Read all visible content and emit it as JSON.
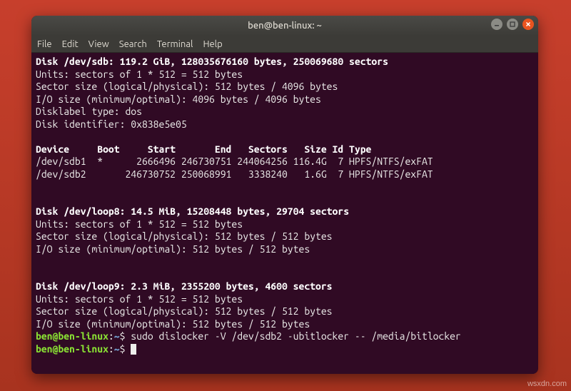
{
  "window": {
    "title": "ben@ben-linux: ~"
  },
  "menu": {
    "file": "File",
    "edit": "Edit",
    "view": "View",
    "search": "Search",
    "terminal": "Terminal",
    "help": "Help"
  },
  "out": {
    "sdb_header": "Disk /dev/sdb: 119.2 GiB, 128035676160 bytes, 250069680 sectors",
    "sdb_units": "Units: sectors of 1 * 512 = 512 bytes",
    "sdb_secsize": "Sector size (logical/physical): 512 bytes / 4096 bytes",
    "sdb_iosize": "I/O size (minimum/optimal): 4096 bytes / 4096 bytes",
    "sdb_label": "Disklabel type: dos",
    "sdb_ident": "Disk identifier: 0x838e5e05",
    "blank1": "",
    "part_header": "Device     Boot     Start       End   Sectors   Size Id Type",
    "part_row1": "/dev/sdb1  *      2666496 246730751 244064256 116.4G  7 HPFS/NTFS/exFAT",
    "part_row2": "/dev/sdb2       246730752 250068991   3338240   1.6G  7 HPFS/NTFS/exFAT",
    "blank2": "",
    "blank3": "",
    "loop8_header": "Disk /dev/loop8: 14.5 MiB, 15208448 bytes, 29704 sectors",
    "loop8_units": "Units: sectors of 1 * 512 = 512 bytes",
    "loop8_secsize": "Sector size (logical/physical): 512 bytes / 512 bytes",
    "loop8_iosize": "I/O size (minimum/optimal): 512 bytes / 512 bytes",
    "blank4": "",
    "blank5": "",
    "loop9_header": "Disk /dev/loop9: 2.3 MiB, 2355200 bytes, 4600 sectors",
    "loop9_units": "Units: sectors of 1 * 512 = 512 bytes",
    "loop9_secsize": "Sector size (logical/physical): 512 bytes / 512 bytes",
    "loop9_iosize": "I/O size (minimum/optimal): 512 bytes / 512 bytes"
  },
  "prompt": {
    "userhost": "ben@ben-linux",
    "colon": ":",
    "path": "~",
    "dollar": "$ ",
    "cmd1": "sudo dislocker -V /dev/sdb2 -ubitlocker -- /media/bitlocker",
    "cmd2": ""
  },
  "watermark": "wsxdn.com"
}
